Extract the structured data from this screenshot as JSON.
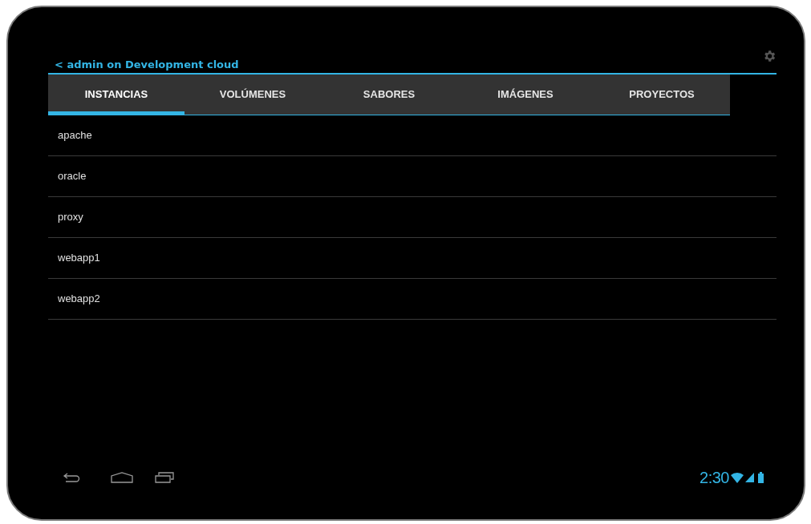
{
  "action_bar": {
    "title": "< admin on Development cloud"
  },
  "tabs": [
    {
      "label": "INSTANCIAS",
      "selected": true
    },
    {
      "label": "VOLÚMENES",
      "selected": false
    },
    {
      "label": "SABORES",
      "selected": false
    },
    {
      "label": "IMÁGENES",
      "selected": false
    },
    {
      "label": "PROYECTOS",
      "selected": false
    }
  ],
  "instances": [
    "apache",
    "oracle",
    "proxy",
    "webapp1",
    "webapp2"
  ],
  "status_bar": {
    "time": "2:30"
  }
}
